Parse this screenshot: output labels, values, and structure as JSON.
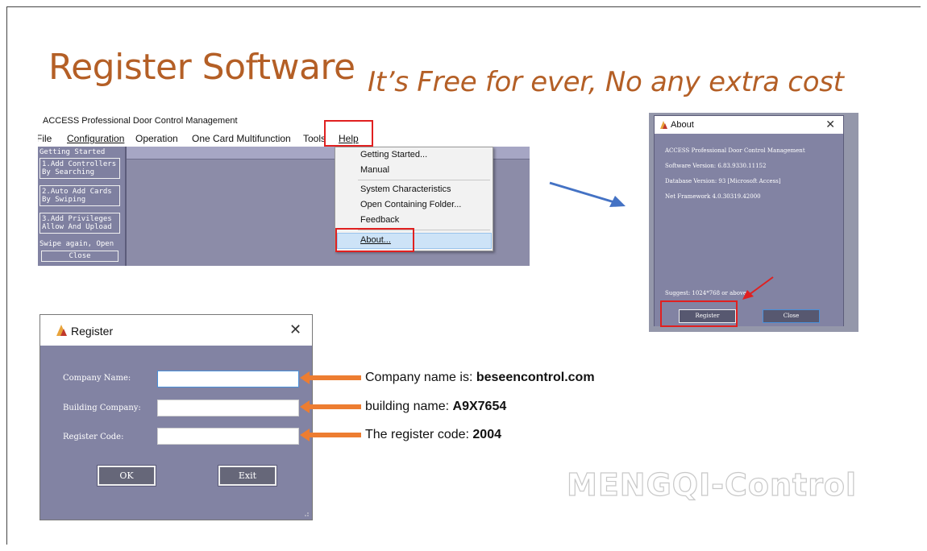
{
  "slide": {
    "title": "Register Software",
    "subtitle": "It’s Free for ever, No any extra cost",
    "watermark": "MENGQI-Control"
  },
  "app": {
    "window_title": "ACCESS Professional Door Control Management",
    "menu": [
      "File",
      "Configuration",
      "Operation",
      "One Card Multifunction",
      "Tools",
      "Help"
    ],
    "sidebar": {
      "header": "Getting Started",
      "buttons": [
        {
          "line1": "1.Add Controllers",
          "line2": "By Searching"
        },
        {
          "line1": "2.Auto Add Cards",
          "line2": "By Swiping"
        },
        {
          "line1": "3.Add Privileges",
          "line2": "Allow And Upload"
        }
      ],
      "swipe_text": "Swipe again, Open",
      "close_label": "Close"
    },
    "help_menu": [
      "Getting Started...",
      "Manual",
      "System Characteristics",
      "Open Containing Folder...",
      "Feedback",
      "About..."
    ]
  },
  "about_dialog": {
    "title": "About",
    "lines": [
      "ACCESS Professional Door Control Management",
      "Software Version: 6.83.9330.11152",
      "Database Version: 93  [Microsoft Access]",
      " Net Framework 4.0.30319.42000"
    ],
    "suggest": "Suggest: 1024*768 or above",
    "register_label": "Register",
    "close_label": "Close"
  },
  "register_dialog": {
    "title": "Register",
    "fields": [
      {
        "label": "Company Name:",
        "value": ""
      },
      {
        "label": "Building Company:",
        "value": ""
      },
      {
        "label": "Register Code:",
        "value": ""
      }
    ],
    "ok_label": "OK",
    "exit_label": "Exit"
  },
  "annotations": [
    {
      "prefix": "Company name is: ",
      "value": "beseencontrol.com"
    },
    {
      "prefix": "building name: ",
      "value": "A9X7654"
    },
    {
      "prefix": "The register code: ",
      "value": "2004"
    }
  ],
  "colors": {
    "title": "#b45f26",
    "dialog_body": "#8283a3",
    "highlight_red": "#e02020",
    "annotation_arrow": "#ed7d31",
    "blue_arrow": "#4472c4"
  }
}
